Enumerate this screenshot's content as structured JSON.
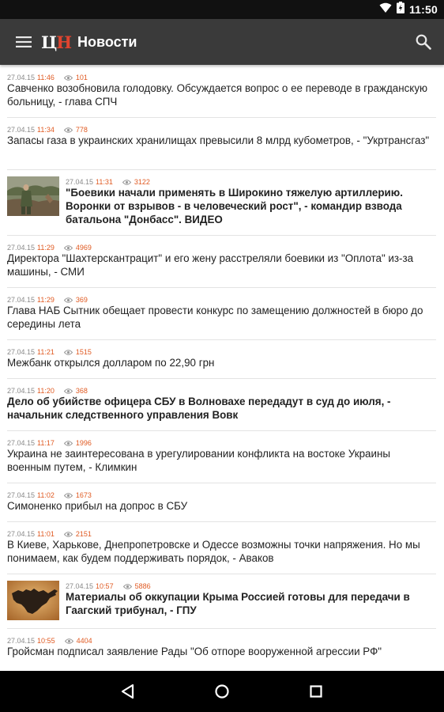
{
  "status_bar": {
    "time": "11:50"
  },
  "toolbar": {
    "logo_c": "Ц",
    "logo_n": "Н",
    "title": "Новости"
  },
  "icons": {
    "menu": "hamburger-menu-icon",
    "search": "search-icon",
    "views": "eye-icon",
    "back": "back-triangle-icon",
    "home": "home-circle-icon",
    "recents": "recents-square-icon"
  },
  "colors": {
    "toolbar": "#3a3a3a",
    "accent": "#e05a22",
    "logo_red": "#e0442f"
  },
  "news": [
    {
      "date": "27.04.15",
      "time": "11:46",
      "views": "101",
      "bold": false,
      "has_image": false,
      "headline": "Савченко возобновила голодовку. Обсуждается вопрос о ее переводе в гражданскую больницу, - глава СПЧ"
    },
    {
      "date": "27.04.15",
      "time": "11:34",
      "views": "778",
      "bold": false,
      "has_image": false,
      "headline": "Запасы газа в украинских хранилищах превысили 8 млрд кубометров, - \"Укртрансгаз\""
    },
    {
      "date": "27.04.15",
      "time": "11:31",
      "views": "3122",
      "bold": true,
      "has_image": true,
      "image": "soldier-photo",
      "headline": "\"Боевики начали применять в Широкино тяжелую артиллерию. Воронки от взрывов - в человеческий рост\", - командир взвода батальона \"Донбасс\". ВИДЕО"
    },
    {
      "date": "27.04.15",
      "time": "11:29",
      "views": "4969",
      "bold": false,
      "has_image": false,
      "headline": "Директора \"Шахтерскантрацит\" и его жену расстреляли боевики из \"Оплота\" из-за машины, - СМИ"
    },
    {
      "date": "27.04.15",
      "time": "11:29",
      "views": "369",
      "bold": false,
      "has_image": false,
      "headline": "Глава НАБ Сытник обещает провести конкурс по замещению должностей в бюро до середины лета"
    },
    {
      "date": "27.04.15",
      "time": "11:21",
      "views": "1515",
      "bold": false,
      "has_image": false,
      "headline": "Межбанк открылся долларом по 22,90 грн"
    },
    {
      "date": "27.04.15",
      "time": "11:20",
      "views": "368",
      "bold": true,
      "has_image": false,
      "headline": "Дело об убийстве офицера СБУ в Волновахе передадут в суд до июля, - начальник следственного управления Вовк"
    },
    {
      "date": "27.04.15",
      "time": "11:17",
      "views": "1996",
      "bold": false,
      "has_image": false,
      "headline": "Украина не заинтересована в урегулировании конфликта на востоке Украины военным путем, - Климкин"
    },
    {
      "date": "27.04.15",
      "time": "11:02",
      "views": "1673",
      "bold": false,
      "has_image": false,
      "headline": "Симоненко прибыл на допрос в СБУ"
    },
    {
      "date": "27.04.15",
      "time": "11:01",
      "views": "2151",
      "bold": false,
      "has_image": false,
      "headline": "В Киеве, Харькове, Днепропетровске и Одессе возможны точки напряжения. Но мы понимаем, как будем поддерживать порядок, - Аваков"
    },
    {
      "date": "27.04.15",
      "time": "10:57",
      "views": "5886",
      "bold": true,
      "has_image": true,
      "image": "crimea-map",
      "headline": "Материалы об оккупации Крыма Россией готовы для передачи в Гаагский трибунал, - ГПУ"
    },
    {
      "date": "27.04.15",
      "time": "10:55",
      "views": "4404",
      "bold": false,
      "has_image": false,
      "headline": "Гройсман подписал заявление Рады \"Об отпоре вооруженной агрессии РФ\""
    }
  ]
}
